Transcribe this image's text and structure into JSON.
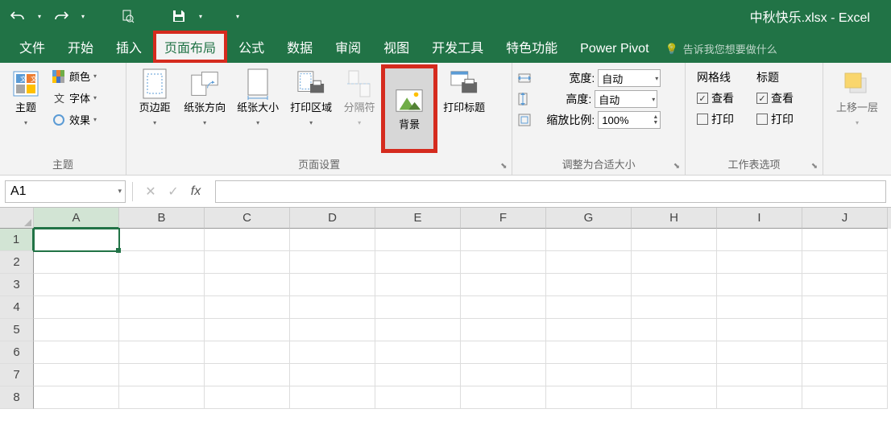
{
  "app": {
    "title": "中秋快乐.xlsx - Excel"
  },
  "qat": {
    "undo": "↶",
    "redo": "↷",
    "preview": "🔍",
    "save": "💾"
  },
  "tabs": {
    "file": "文件",
    "home": "开始",
    "insert": "插入",
    "page_layout": "页面布局",
    "formulas": "公式",
    "data": "数据",
    "review": "审阅",
    "view": "视图",
    "dev": "开发工具",
    "special": "特色功能",
    "pivot": "Power Pivot",
    "tellme": "告诉我您想要做什么"
  },
  "ribbon": {
    "themes": {
      "label": "主题",
      "theme": "主题",
      "colors": "颜色",
      "fonts": "字体",
      "effects": "效果"
    },
    "page_setup": {
      "label": "页面设置",
      "margins": "页边距",
      "orientation": "纸张方向",
      "size": "纸张大小",
      "print_area": "打印区域",
      "breaks": "分隔符",
      "background": "背景",
      "titles": "打印标题"
    },
    "scale": {
      "label": "调整为合适大小",
      "width": "宽度:",
      "height": "高度:",
      "scale_lbl": "缩放比例:",
      "auto": "自动",
      "scale_val": "100%"
    },
    "sheet": {
      "label": "工作表选项",
      "gridlines": "网格线",
      "headings": "标题",
      "view": "查看",
      "print": "打印"
    },
    "arrange": {
      "label": "",
      "forward": "上移一层"
    }
  },
  "formula_bar": {
    "name": "A1",
    "fx": "fx"
  },
  "grid": {
    "columns": [
      "A",
      "B",
      "C",
      "D",
      "E",
      "F",
      "G",
      "H",
      "I",
      "J"
    ],
    "rows": [
      "1",
      "2",
      "3",
      "4",
      "5",
      "6",
      "7",
      "8"
    ],
    "active": "A1"
  },
  "tellme_icon": "💡"
}
